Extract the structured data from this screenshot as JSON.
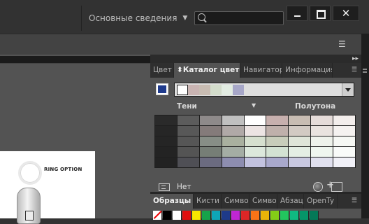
{
  "header": {
    "workspace_label": "Основные сведения"
  },
  "panel_top": {
    "tabs": [
      {
        "label": "Цвет",
        "active": false
      },
      {
        "label": "Каталог цветов",
        "active": true
      },
      {
        "label": "Навигатор",
        "active": false
      },
      {
        "label": "Информация",
        "active": false
      }
    ],
    "current_color": "#1f3b8d",
    "theme_colors": [
      "#ffffff",
      "#c9b4b2",
      "#c8bcb2",
      "#d3dccb",
      "#e2ece2",
      "#a7a7c8"
    ],
    "shades_label": "Тени",
    "halftone_label": "Полутона",
    "footer_label": "Нет",
    "grid_colors": [
      [
        "#2a2a2a",
        "#5c5c5c",
        "#8e8a8a",
        "#c0c0c0",
        "#ffffff",
        "#c7b0ae",
        "#c8bdb3",
        "#e5dcd9",
        "#f3eeec"
      ],
      [
        "#262626",
        "#585858",
        "#847b7a",
        "#b0a9a7",
        "#ece4e3",
        "#bfb0ab",
        "#d2cac3",
        "#e9e3df",
        "#f5f2f0"
      ],
      [
        "#252525",
        "#565656",
        "#878e86",
        "#a9b09f",
        "#d6e0cf",
        "#c8cdbb",
        "#dfe5d9",
        "#eef2eb",
        "#f6f8f4"
      ],
      [
        "#232323",
        "#545454",
        "#767e76",
        "#a4ada4",
        "#dce8dc",
        "#d3e2d3",
        "#e4eee4",
        "#eff6ef",
        "#f9fbf9"
      ],
      [
        "#222222",
        "#4f4f55",
        "#6b6b80",
        "#8d8db0",
        "#c2c2df",
        "#a8a8cc",
        "#c8c8e0",
        "#e0e0ee",
        "#f0f0f7"
      ]
    ]
  },
  "panel_bottom": {
    "tabs": [
      {
        "label": "Образцы",
        "active": true
      },
      {
        "label": "Кисти",
        "active": false
      },
      {
        "label": "Симво",
        "active": false
      },
      {
        "label": "Симво",
        "active": false
      },
      {
        "label": "Абзац",
        "active": false
      },
      {
        "label": "OpenTy",
        "active": false
      }
    ],
    "swatch_colors": [
      "#000000",
      "#ffffff",
      "#e01010",
      "#f7e600",
      "#16a34a",
      "#0ea5b7",
      "#1e3a8a",
      "#c026d3",
      "#dc2626",
      "#f97316",
      "#eab308",
      "#84cc16",
      "#22c55e",
      "#10b981",
      "#059669",
      "#047857"
    ]
  },
  "canvas": {
    "ring_label": "RING OPTION"
  }
}
